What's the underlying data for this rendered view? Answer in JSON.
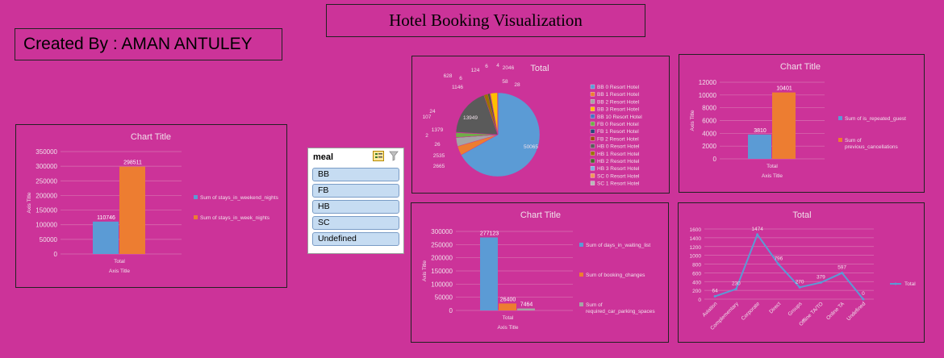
{
  "header": {
    "title": "Hotel Booking Visualization",
    "creator": "Created By : AMAN ANTULEY"
  },
  "slicer": {
    "field": "meal",
    "items": [
      "BB",
      "FB",
      "HB",
      "SC",
      "Undefined"
    ]
  },
  "colors": {
    "background": "#cc3399",
    "blue": "#5b9bd5",
    "orange": "#ed7d31",
    "gray": "#a5a5a5",
    "yellow": "#ffc000",
    "darkgray": "#5a5a5a"
  },
  "chart_data": [
    {
      "id": "weekend",
      "type": "bar",
      "title": "Chart Title",
      "xlabel": "Axis Title",
      "ylabel": "Axis Title",
      "categories": [
        "Total"
      ],
      "ylim": [
        0,
        350000
      ],
      "yticks": [
        "350000",
        "300000",
        "250000",
        "200000",
        "150000",
        "100000",
        "50000",
        "0"
      ],
      "series": [
        {
          "name": "Sum of stays_in_weekend_nights",
          "values": [
            110746
          ]
        },
        {
          "name": "Sum of stays_in_week_nights",
          "values": [
            298511
          ]
        }
      ]
    },
    {
      "id": "pie",
      "type": "pie",
      "title": "Total",
      "legend": [
        "BB 0 Resort Hotel",
        "BB 1 Resort Hotel",
        "BB 2 Resort Hotel",
        "BB 3 Resort Hotel",
        "BB 10 Resort Hotel",
        "FB 0 Resort Hotel",
        "FB 1 Resort Hotel",
        "FB 2 Resort Hotel",
        "HB 0 Resort Hotel",
        "HB 1 Resort Hotel",
        "HB 2 Resort Hotel",
        "HB 3 Resort Hotel",
        "SC 0 Resort Hotel",
        "SC 1 Resort Hotel"
      ],
      "values": [
        50065,
        2665,
        2535,
        26,
        2,
        1379,
        107,
        24,
        13949,
        1146,
        628,
        6,
        124,
        6,
        4,
        2046,
        58,
        28
      ]
    },
    {
      "id": "repeated",
      "type": "bar",
      "title": "Chart Title",
      "xlabel": "Axis Title",
      "ylabel": "Axis Title",
      "categories": [
        "Total"
      ],
      "ylim": [
        0,
        12000
      ],
      "yticks": [
        "12000",
        "10000",
        "8000",
        "6000",
        "4000",
        "2000",
        "0"
      ],
      "series": [
        {
          "name": "Sum of is_repeated_guest",
          "values": [
            3810
          ]
        },
        {
          "name": "Sum of previous_cancellations",
          "values": [
            10401
          ]
        }
      ]
    },
    {
      "id": "waiting",
      "type": "bar",
      "title": "Chart Title",
      "xlabel": "Axis Title",
      "ylabel": "Axis Title",
      "categories": [
        "Total"
      ],
      "ylim": [
        0,
        300000
      ],
      "yticks": [
        "300000",
        "250000",
        "200000",
        "150000",
        "100000",
        "50000",
        "0"
      ],
      "series": [
        {
          "name": "Sum of days_in_waiting_list",
          "values": [
            277123
          ]
        },
        {
          "name": "Sum of booking_changes",
          "values": [
            26400
          ]
        },
        {
          "name": "Sum of required_car_parking_spaces",
          "values": [
            7464
          ]
        }
      ]
    },
    {
      "id": "segment",
      "type": "line",
      "title": "Total",
      "categories": [
        "Aviation",
        "Complementary",
        "Corporate",
        "Direct",
        "Groups",
        "Offline TA/TO",
        "Online TA",
        "Undefined"
      ],
      "values": [
        64,
        230,
        1474,
        796,
        270,
        379,
        597,
        0
      ],
      "ylim": [
        0,
        1600
      ],
      "yticks": [
        "1600",
        "1400",
        "1200",
        "1000",
        "800",
        "600",
        "400",
        "200",
        "0"
      ],
      "series": [
        {
          "name": "Total"
        }
      ]
    }
  ]
}
